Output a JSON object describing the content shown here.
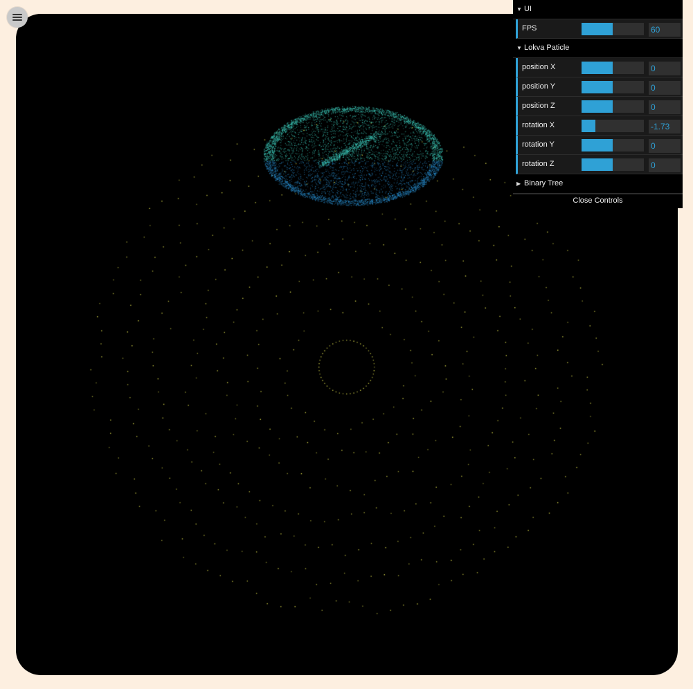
{
  "menu": {
    "icon": "hamburger-icon"
  },
  "gui": {
    "ui_folder": {
      "title": "UI",
      "fps": {
        "label": "FPS",
        "value": "60",
        "fraction": 0.5
      }
    },
    "particle_folder": {
      "title": "Lokva Paticle",
      "controls": [
        {
          "name": "position-x",
          "label": "position X",
          "value": "0",
          "fraction": 0.5
        },
        {
          "name": "position-y",
          "label": "position Y",
          "value": "0",
          "fraction": 0.5
        },
        {
          "name": "position-z",
          "label": "position Z",
          "value": "0",
          "fraction": 0.5
        },
        {
          "name": "rotation-x",
          "label": "rotation X",
          "value": "-1.73",
          "fraction": 0.22
        },
        {
          "name": "rotation-y",
          "label": "rotation Y",
          "value": "0",
          "fraction": 0.5
        },
        {
          "name": "rotation-z",
          "label": "rotation Z",
          "value": "0",
          "fraction": 0.5
        }
      ]
    },
    "binary_folder": {
      "title": "Binary Tree"
    },
    "close_label": "Close Controls"
  },
  "colors": {
    "page_bg": "#fdefe0",
    "canvas_bg": "#000000",
    "accent": "#2fa1d6",
    "dot_yellow": "#d8d84a",
    "cloud_cyan": "#3fd0c0",
    "cloud_blue": "#2a8fd0"
  }
}
